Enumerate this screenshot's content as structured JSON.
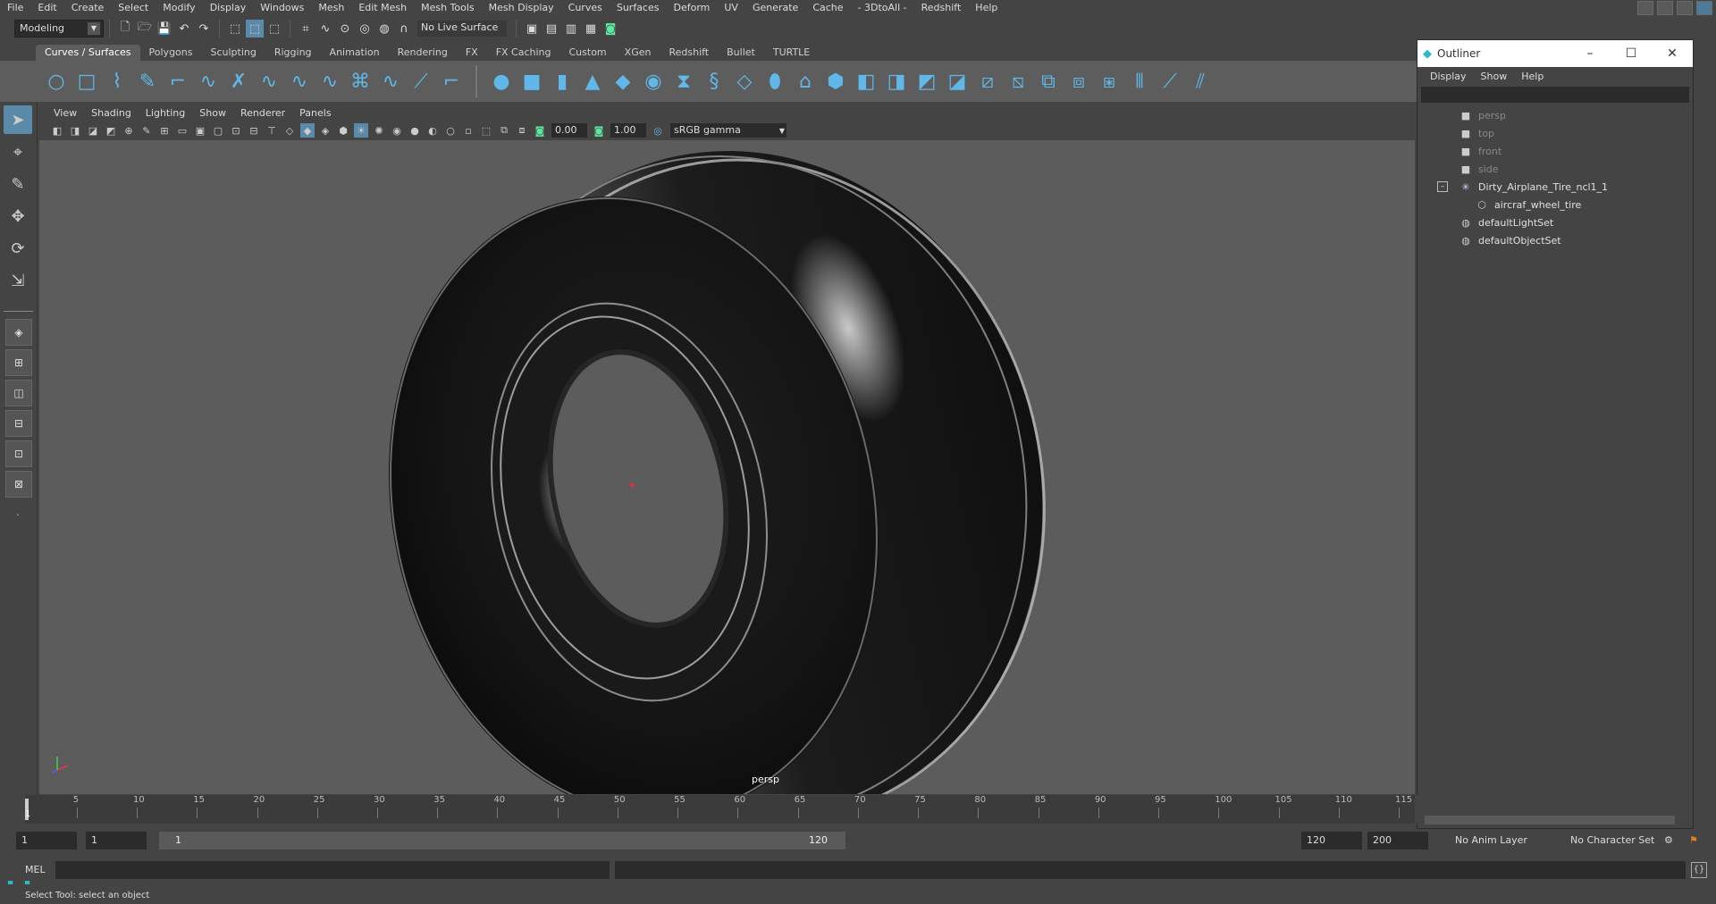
{
  "menubar": {
    "items": [
      "File",
      "Edit",
      "Create",
      "Select",
      "Modify",
      "Display",
      "Windows",
      "Mesh",
      "Edit Mesh",
      "Mesh Tools",
      "Mesh Display",
      "Curves",
      "Surfaces",
      "Deform",
      "UV",
      "Generate",
      "Cache",
      "- 3DtoAll -",
      "Redshift",
      "Help"
    ]
  },
  "statusline": {
    "mode": "Modeling",
    "live_surface": "No Live Surface"
  },
  "shelf": {
    "tabs": [
      "Curves / Surfaces",
      "Polygons",
      "Sculpting",
      "Rigging",
      "Animation",
      "Rendering",
      "FX",
      "FX Caching",
      "Custom",
      "XGen",
      "Redshift",
      "Bullet",
      "TURTLE"
    ],
    "active_tab": "Curves / Surfaces"
  },
  "viewport": {
    "menus": [
      "View",
      "Shading",
      "Lighting",
      "Show",
      "Renderer",
      "Panels"
    ],
    "exposure": "0.00",
    "gamma": "1.00",
    "color_space": "sRGB gamma",
    "camera_label": "persp"
  },
  "outliner": {
    "title": "Outliner",
    "menus": [
      "Display",
      "Show",
      "Help"
    ],
    "items": [
      {
        "label": "persp",
        "icon": "camera-icon",
        "dim": true
      },
      {
        "label": "top",
        "icon": "camera-icon",
        "dim": true
      },
      {
        "label": "front",
        "icon": "camera-icon",
        "dim": true
      },
      {
        "label": "side",
        "icon": "camera-icon",
        "dim": true
      },
      {
        "label": "Dirty_Airplane_Tire_ncl1_1",
        "icon": "group-icon",
        "dim": false
      },
      {
        "label": "aircraf_wheel_tire",
        "icon": "mesh-icon",
        "dim": false
      },
      {
        "label": "defaultLightSet",
        "icon": "set-icon",
        "dim": false
      },
      {
        "label": "defaultObjectSet",
        "icon": "set-icon",
        "dim": false
      }
    ]
  },
  "timeslider": {
    "ticks": [
      "5",
      "10",
      "15",
      "20",
      "25",
      "30",
      "35",
      "40",
      "45",
      "50",
      "55",
      "60",
      "65",
      "70",
      "75",
      "80",
      "85",
      "90",
      "95",
      "100",
      "105",
      "110",
      "115"
    ],
    "current_frame": "1"
  },
  "rangeslider": {
    "start_field": "1",
    "start_field2": "1",
    "range_start": "1",
    "range_end": "120",
    "end_field": "120",
    "end_field2": "200",
    "anim_layer": "No Anim Layer",
    "char_set": "No Character Set"
  },
  "cmdline": {
    "label": "MEL"
  },
  "helpline": {
    "text": "Select Tool: select an object"
  }
}
